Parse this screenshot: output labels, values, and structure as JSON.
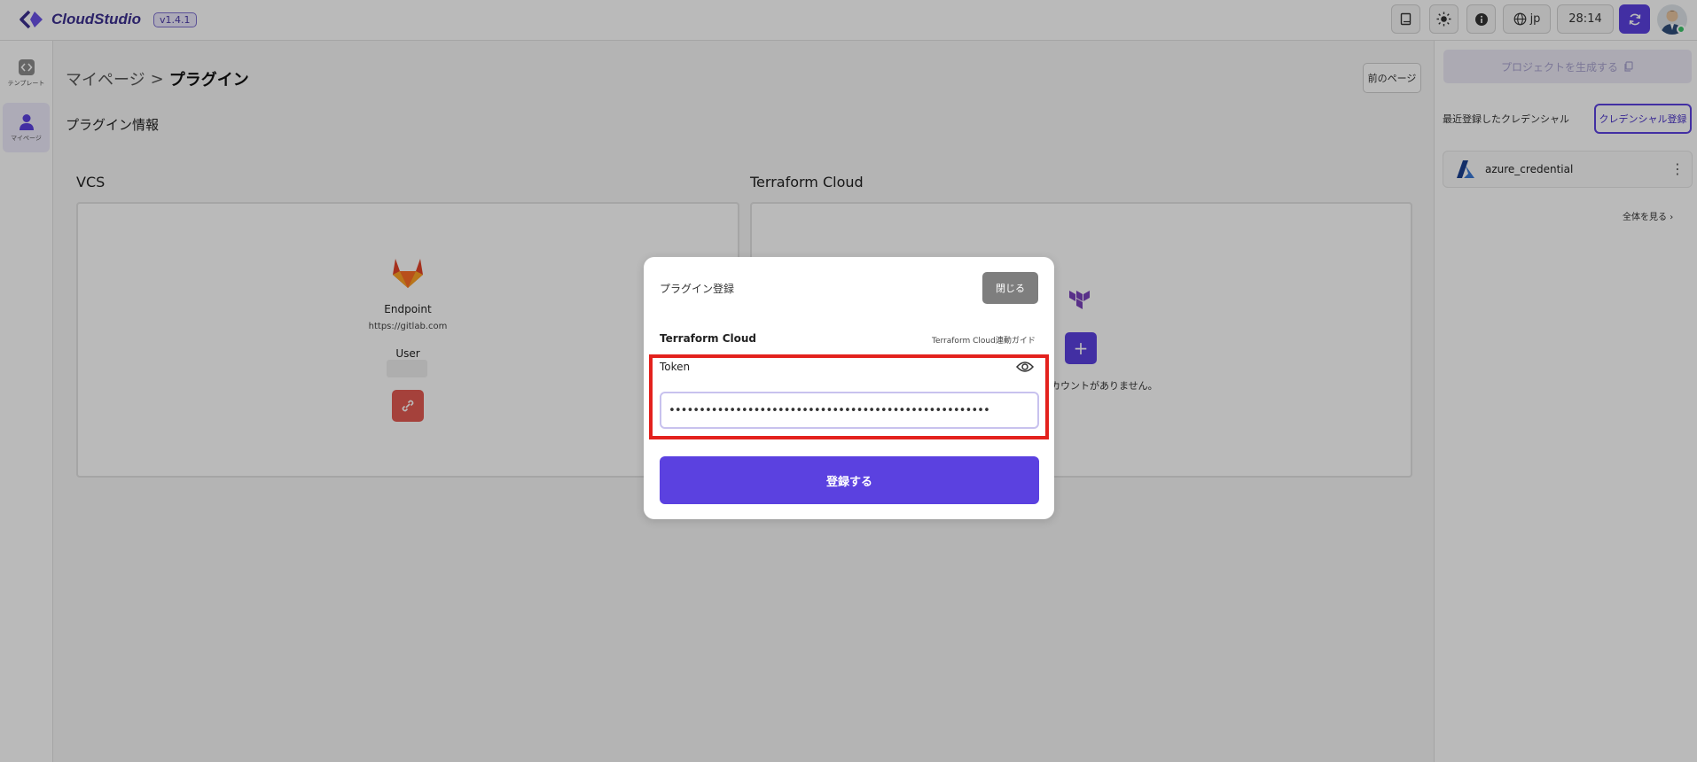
{
  "app": {
    "name": "CloudStudio",
    "version": "v1.4.1"
  },
  "header": {
    "buttons": [
      {
        "icon": "book-icon"
      },
      {
        "icon": "sun-icon"
      },
      {
        "icon": "info-icon"
      },
      {
        "icon": "globe-icon",
        "label": "jp"
      },
      {
        "label": "28:14"
      },
      {
        "icon": "refresh-icon"
      }
    ],
    "accent_color": "#5b41e0"
  },
  "rail": {
    "items": [
      {
        "label": "テンプレート",
        "icon": "template-icon"
      },
      {
        "label": "マイページ",
        "icon": "user-icon",
        "active": true
      }
    ]
  },
  "main": {
    "breadcrumb": {
      "parent": "マイページ",
      "separator": ">",
      "current": "プラグイン"
    },
    "prev_page_label": "前のページ",
    "section_title": "プラグイン情報",
    "vcs": {
      "title": "VCS",
      "endpoint_label": "Endpoint",
      "endpoint_value": "https://gitlab.com",
      "user_label": "User"
    },
    "terraform": {
      "title": "Terraform Cloud",
      "no_account_text": "カウントがありません。"
    }
  },
  "right_panel": {
    "generate_label": "プロジェクトを生成する",
    "recent_label": "最近登録したクレデンシャル",
    "register_label": "クレデンシャル登録",
    "credentials": [
      {
        "name": "azure_credential",
        "icon": "azure-icon"
      }
    ],
    "view_all_label": "全体を見る"
  },
  "modal": {
    "title": "プラグイン登録",
    "close_label": "閉じる",
    "plugin_name": "Terraform Cloud",
    "guide_label": "Terraform Cloud連動ガイド",
    "token_label": "Token",
    "token_value": "•••••••••••••••••••••••••••••••••••••••••••••••••••••",
    "submit_label": "登録する",
    "highlight_color": "#e3211d"
  }
}
